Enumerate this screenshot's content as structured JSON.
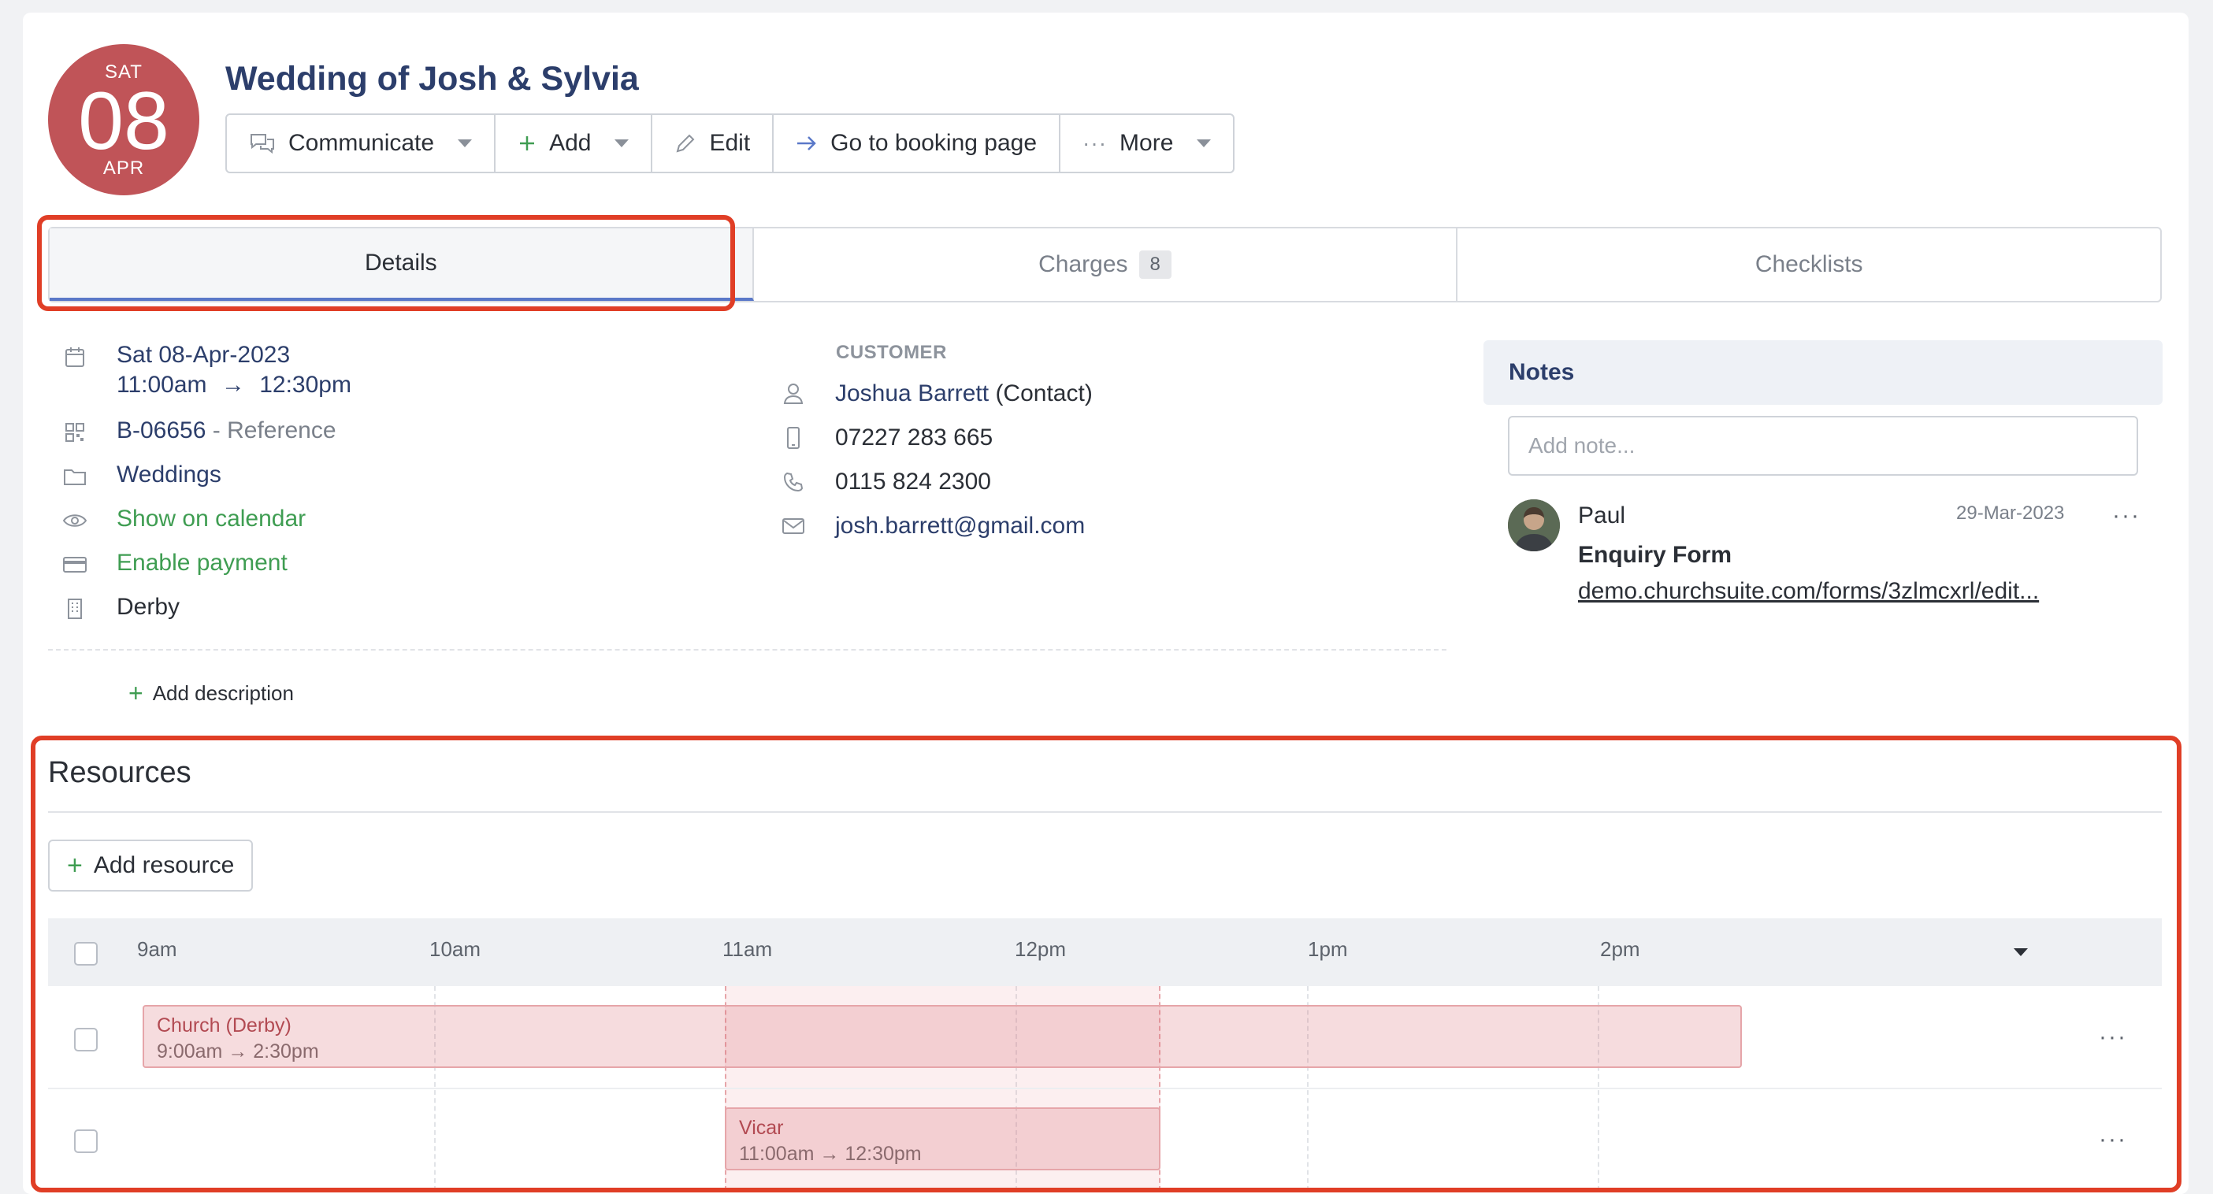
{
  "date_badge": {
    "dow": "SAT",
    "day": "08",
    "month": "APR",
    "color": "#c05458"
  },
  "title": "Wedding of Josh & Sylvia",
  "toolbar": {
    "communicate": "Communicate",
    "add": "Add",
    "edit": "Edit",
    "go_booking": "Go to booking page",
    "more": "More"
  },
  "tabs": {
    "details": "Details",
    "charges": "Charges",
    "charges_count": "8",
    "checklists": "Checklists"
  },
  "details": {
    "date": "Sat 08-Apr-2023",
    "time_start": "11:00am",
    "arrow": "→",
    "time_end": "12:30pm",
    "ref_code": "B-06656",
    "ref_suffix": " - Reference",
    "category": "Weddings",
    "show_calendar": "Show on calendar",
    "enable_payment": "Enable payment",
    "site": "Derby",
    "add_description": "Add description"
  },
  "customer": {
    "label": "CUSTOMER",
    "name": "Joshua Barrett",
    "name_suffix": " (Contact)",
    "mobile": "07227 283 665",
    "phone": "0115 824 2300",
    "email": "josh.barrett@gmail.com"
  },
  "notes": {
    "heading": "Notes",
    "placeholder": "Add note...",
    "items": [
      {
        "author": "Paul",
        "date": "29-Mar-2023",
        "title": "Enquiry Form",
        "link": "demo.churchsuite.com/forms/3zlmcxrl/edit..."
      }
    ]
  },
  "resources": {
    "heading": "Resources",
    "add_label": "Add resource",
    "hours": [
      "9am",
      "10am",
      "11am",
      "12pm",
      "1pm",
      "2pm"
    ],
    "rows": [
      {
        "name": "Church (Derby)",
        "time": "9:00am → 2:30pm"
      },
      {
        "name": "Vicar",
        "time": "11:00am → 12:30pm"
      }
    ]
  },
  "colors": {
    "accent": "#2c3e6b",
    "green": "#3f9d52",
    "highlight": "#e03e26",
    "booking_bar": "#e6a5a9"
  }
}
